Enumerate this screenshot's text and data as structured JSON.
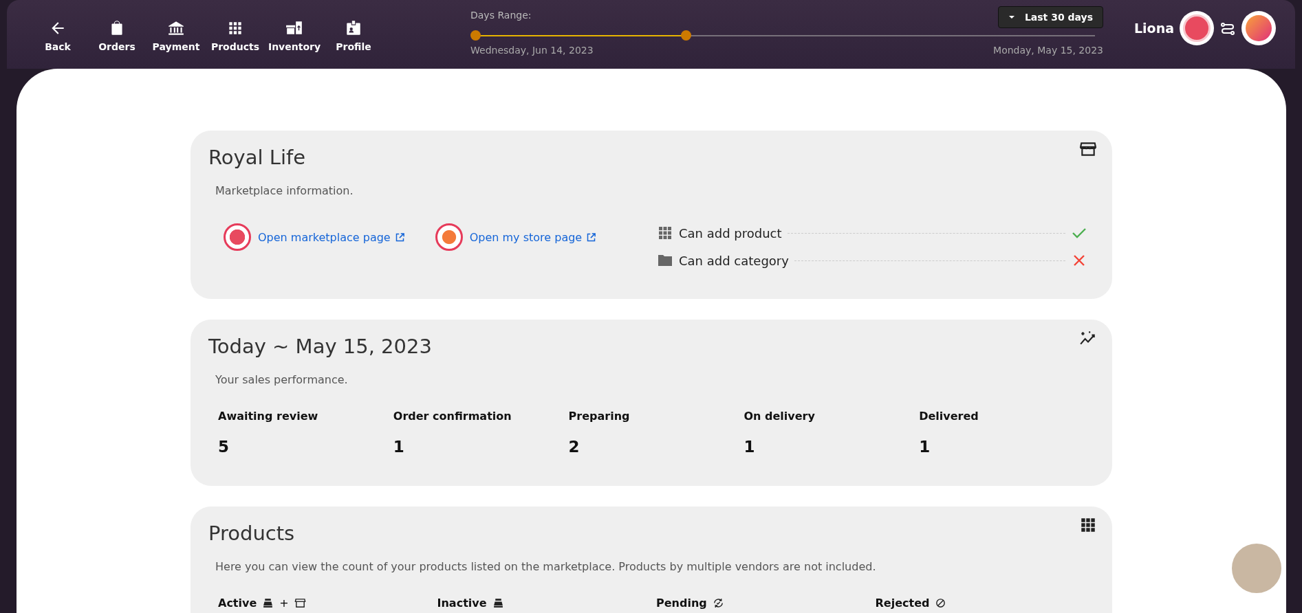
{
  "nav": [
    {
      "label": "Back",
      "kind": "back"
    },
    {
      "label": "Orders",
      "kind": "orders"
    },
    {
      "label": "Payment",
      "kind": "payment"
    },
    {
      "label": "Products",
      "kind": "products"
    },
    {
      "label": "Inventory",
      "kind": "inventory"
    },
    {
      "label": "Profile",
      "kind": "profile"
    }
  ],
  "range": {
    "label": "Days Range:",
    "start": "Wednesday, Jun 14, 2023",
    "end": "Monday, May 15, 2023",
    "level": 0.334,
    "preset": "Last 30 days"
  },
  "user": {
    "name": "Liona"
  },
  "store": {
    "title": "Royal Life",
    "subtitle": "Marketplace information.",
    "links": [
      {
        "label": "Open marketplace page",
        "kind": "market"
      },
      {
        "label": "Open my store page",
        "kind": "store"
      }
    ],
    "permissions": [
      {
        "label": "Can add product",
        "kind": "grid",
        "checked": true
      },
      {
        "label": "Can add category",
        "kind": "folder",
        "checked": false
      }
    ]
  },
  "sales": {
    "title": "Today ~ May 15, 2023",
    "subtitle": "Your sales performance.",
    "stats": [
      {
        "label": "Awaiting review",
        "value": "5"
      },
      {
        "label": "Order confirmation",
        "value": "1"
      },
      {
        "label": "Preparing",
        "value": "2"
      },
      {
        "label": "On delivery",
        "value": "1"
      },
      {
        "label": "Delivered",
        "value": "1"
      }
    ]
  },
  "products": {
    "title": "Products",
    "subtitle": "Here you can view the count of your products listed on the marketplace. Products by multiple vendors are not included.",
    "columns": [
      {
        "label": "Active",
        "kind": "active",
        "joiner": "+"
      },
      {
        "label": "Inactive",
        "kind": "inactive"
      },
      {
        "label": "Pending",
        "kind": "pending"
      },
      {
        "label": "Rejected",
        "kind": "rejected"
      }
    ]
  }
}
